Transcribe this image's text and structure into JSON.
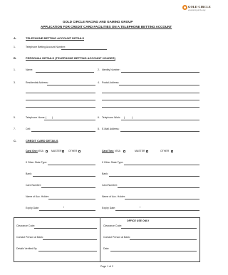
{
  "header": {
    "logo_text": "GOLD CIRCLE",
    "logo_tagline": "entertaining all the way",
    "title_line1": "GOLD CIRCLE RACING AND GAMING GROUP",
    "title_line2": "APPLICATION FOR CREDIT CARD FACILITIES ON A TELEPHONE BETTING ACCOUNT"
  },
  "section_a": {
    "letter": "A.",
    "title": "TELEPHONE BETTING ACCOUNT DETAILS",
    "item1_num": "1.",
    "item1_label": "Telephone Betting Account Number:"
  },
  "section_b": {
    "letter": "B.",
    "title": "PERSONAL DETAILS (TELEPHONE BETTING ACCOUNT HOLDER)",
    "fields": {
      "name_num": "1.",
      "name": "Name:",
      "id_num": "2.",
      "id": "Identity Number:",
      "res_num": "3.",
      "res": "Residential Address:",
      "postal_num": "4.",
      "postal": "Postal Address:",
      "telhome_num": "5.",
      "telhome": "Telephone Home:",
      "telwork_num": "6.",
      "telwork": "Telephone Work:",
      "cell_num": "7.",
      "cell": "Cell:",
      "email_num": "8.",
      "email": "E-Mail Address:",
      "paren_open": "(",
      "paren_close": ")"
    }
  },
  "section_c": {
    "letter": "C.",
    "title": "CREDIT CARD DETAILS",
    "card1": {
      "label": "Card One:",
      "options": [
        "VISA",
        "MASTER",
        "OTHER"
      ],
      "other_state": "If Other State Type:",
      "bank": "Bank:",
      "card_number": "Card Number:",
      "holder": "Name of Acc. Holder:",
      "expiry": "Expiry Date:",
      "slash": "/"
    },
    "card2": {
      "label": "Card Two:",
      "options": [
        "VISA",
        "MASTER",
        "OTHER"
      ],
      "other_state": "If Other State Type:",
      "bank": "Bank:",
      "card_number": "Card Number:",
      "holder": "Name of Acc. Holder:",
      "expiry": "Expiry Date:",
      "slash": "/"
    }
  },
  "office": {
    "title": "OFFICE USE ONLY",
    "clearance_code_left": "Clearance Code:",
    "clearance_code_right": "Clearance Code:",
    "contact_left": "Contact Person at Bank:",
    "contact_right": "Contact Person at Bank:",
    "verified": "Details Verified By:",
    "date": "Date:"
  },
  "footer": {
    "page": "Page 1 of 2"
  }
}
